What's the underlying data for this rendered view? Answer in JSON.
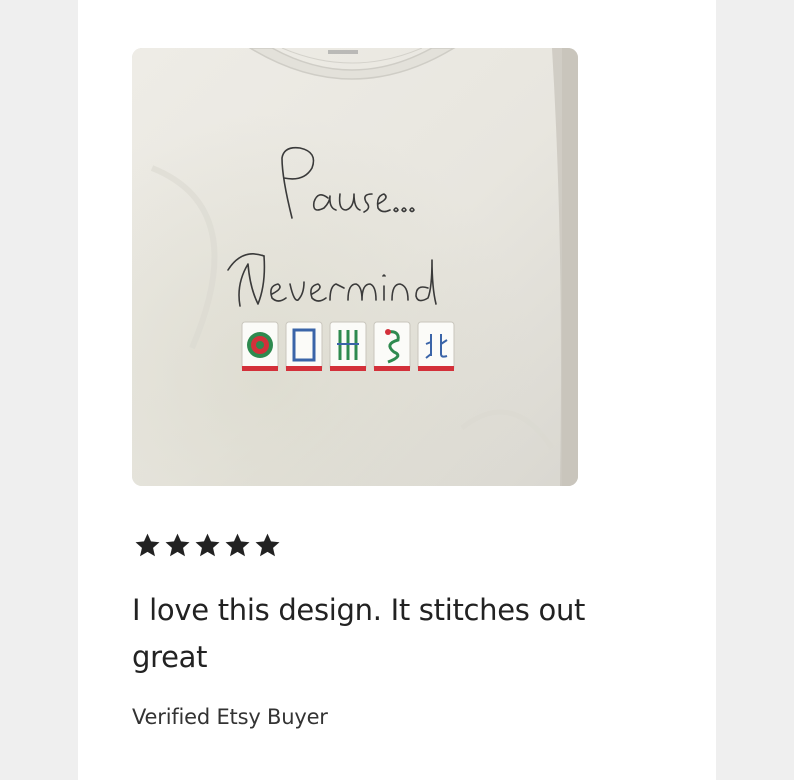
{
  "review": {
    "rating": 5,
    "max_rating": 5,
    "star_color": "#222222",
    "text": "I love this design. It stitches out great",
    "reviewer": "Verified Etsy Buyer",
    "photo": {
      "shirt_color": "#ebe9e3",
      "tile_border_color": "#d3303a",
      "tile_icons": [
        "circle-tile-icon",
        "white-dragon-tile-icon",
        "bamboo-tile-icon",
        "green-dragon-tile-icon",
        "north-wind-tile-icon"
      ]
    }
  }
}
